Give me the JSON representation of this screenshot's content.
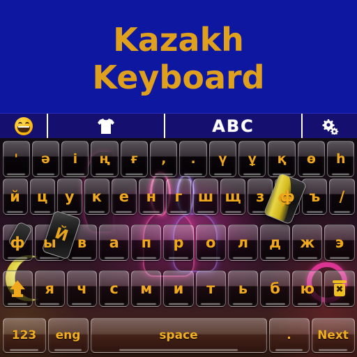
{
  "app": {
    "title_line1": "Kazakh",
    "title_line2": "Keyboard",
    "banner_color": "#0e17a0",
    "title_color": "#dfa11d",
    "toolbar_color": "#151070",
    "key_label_color": "#f0a81c"
  },
  "toolbar": {
    "emoji_icon": "grinning-face-emoji",
    "theme_icon": "tshirt-icon",
    "abc_label": "ABC",
    "settings_icon": "gear-icon"
  },
  "keyboard": {
    "rows": [
      {
        "name": "row-1",
        "keys": [
          {
            "label": "'"
          },
          {
            "label": "ә"
          },
          {
            "label": "і"
          },
          {
            "label": "ң"
          },
          {
            "label": "ғ"
          },
          {
            "label": ","
          },
          {
            "label": "."
          },
          {
            "label": "ү"
          },
          {
            "label": "ұ"
          },
          {
            "label": "қ"
          },
          {
            "label": "ө"
          },
          {
            "label": "һ"
          }
        ]
      },
      {
        "name": "row-2",
        "keys": [
          {
            "label": "й"
          },
          {
            "label": "ц"
          },
          {
            "label": "у"
          },
          {
            "label": "к"
          },
          {
            "label": "е"
          },
          {
            "label": "н"
          },
          {
            "label": "г"
          },
          {
            "label": "ш"
          },
          {
            "label": "щ"
          },
          {
            "label": "з"
          },
          {
            "label": "ф"
          },
          {
            "label": "ъ"
          },
          {
            "label": "/"
          }
        ]
      },
      {
        "name": "row-3",
        "keys": [
          {
            "label": "ф"
          },
          {
            "label": "ы"
          },
          {
            "label": "в"
          },
          {
            "label": "а"
          },
          {
            "label": "п"
          },
          {
            "label": "р"
          },
          {
            "label": "о"
          },
          {
            "label": "л"
          },
          {
            "label": "д"
          },
          {
            "label": "ж"
          },
          {
            "label": "э"
          }
        ]
      },
      {
        "name": "row-4",
        "keys": [
          {
            "label": "",
            "icon": "shift-icon"
          },
          {
            "label": "я"
          },
          {
            "label": "ч"
          },
          {
            "label": "с"
          },
          {
            "label": "м"
          },
          {
            "label": "и"
          },
          {
            "label": "т"
          },
          {
            "label": "ь"
          },
          {
            "label": "б"
          },
          {
            "label": "ю"
          },
          {
            "label": "",
            "icon": "backspace-trash-icon"
          }
        ]
      }
    ],
    "bottom_row": {
      "numeric_label": "123",
      "language_label": "eng",
      "space_label": "space",
      "period_label": ".",
      "next_label": "Next"
    }
  },
  "decorations": {
    "card_glyph_1": "ф",
    "card_glyph_2": "Й"
  }
}
